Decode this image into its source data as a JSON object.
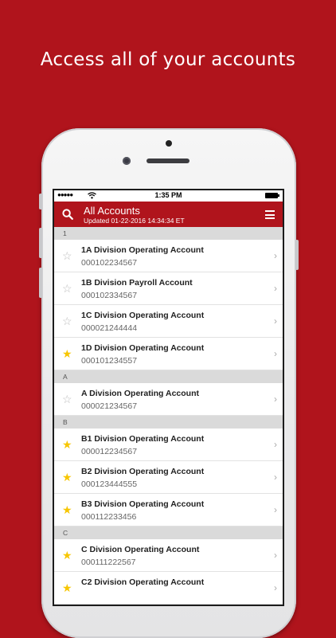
{
  "headline": "Access all of your accounts",
  "colors": {
    "brand": "#b0141c",
    "star_active": "#f7c600",
    "star_inactive": "#bdbdbd"
  },
  "status_bar": {
    "signal": "●●●●●",
    "wifi": "wifi-icon",
    "time": "1:35 PM",
    "battery": "battery-icon"
  },
  "nav": {
    "title": "All Accounts",
    "updated": "Updated  01-22-2016 14:34:34 ET",
    "search_icon": "search-icon",
    "menu_icon": "menu-icon"
  },
  "sections": [
    {
      "header": "1",
      "rows": [
        {
          "name": "1A Division Operating Account",
          "number": "000102234567",
          "starred": false
        },
        {
          "name": "1B Division Payroll Account",
          "number": "000102334567",
          "starred": false
        },
        {
          "name": "1C Division Operating Account",
          "number": "000021244444",
          "starred": false
        },
        {
          "name": "1D Division Operating Account",
          "number": "000101234557",
          "starred": true
        }
      ]
    },
    {
      "header": "A",
      "rows": [
        {
          "name": "A Division Operating Account",
          "number": "000021234567",
          "starred": false
        }
      ]
    },
    {
      "header": "B",
      "rows": [
        {
          "name": "B1 Division Operating Account",
          "number": "000012234567",
          "starred": true
        },
        {
          "name": "B2 Division Operating Account",
          "number": "000123444555",
          "starred": true
        },
        {
          "name": "B3 Division Operating Account",
          "number": "000112233456",
          "starred": true
        }
      ]
    },
    {
      "header": "C",
      "rows": [
        {
          "name": "C Division Operating Account",
          "number": "000111222567",
          "starred": true
        },
        {
          "name": "C2 Division Operating Account",
          "number": "",
          "starred": true
        }
      ]
    }
  ]
}
